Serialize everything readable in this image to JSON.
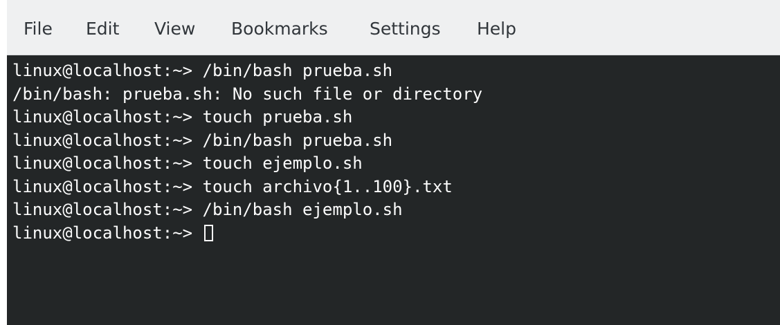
{
  "menubar": {
    "items": [
      "File",
      "Edit",
      "View",
      "Bookmarks",
      "Settings",
      "Help"
    ]
  },
  "terminal": {
    "lines": [
      "linux@localhost:~> /bin/bash prueba.sh",
      "/bin/bash: prueba.sh: No such file or directory",
      "linux@localhost:~> touch prueba.sh",
      "linux@localhost:~> /bin/bash prueba.sh",
      "linux@localhost:~> touch ejemplo.sh",
      "linux@localhost:~> touch archivo{1..100}.txt",
      "linux@localhost:~> /bin/bash ejemplo.sh"
    ],
    "prompt": "linux@localhost:~> "
  },
  "colors": {
    "menubar_bg": "#eff0f1",
    "menu_text": "#31363b",
    "terminal_bg": "#232627",
    "terminal_text": "#fcfcfc"
  }
}
